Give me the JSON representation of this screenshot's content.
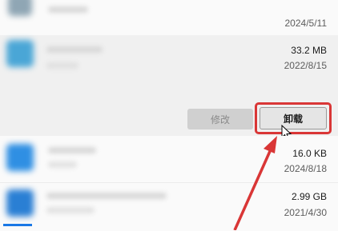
{
  "apps": [
    {
      "size": "",
      "date": "2024/5/11"
    },
    {
      "size": "33.2 MB",
      "date": "2022/8/15"
    },
    {
      "size": "16.0 KB",
      "date": "2024/8/18"
    },
    {
      "size": "2.99 GB",
      "date": "2021/4/30"
    }
  ],
  "buttons": {
    "modify": "修改",
    "uninstall": "卸载"
  },
  "colors": {
    "highlight": "#d93636",
    "accent": "#1a78e6"
  }
}
